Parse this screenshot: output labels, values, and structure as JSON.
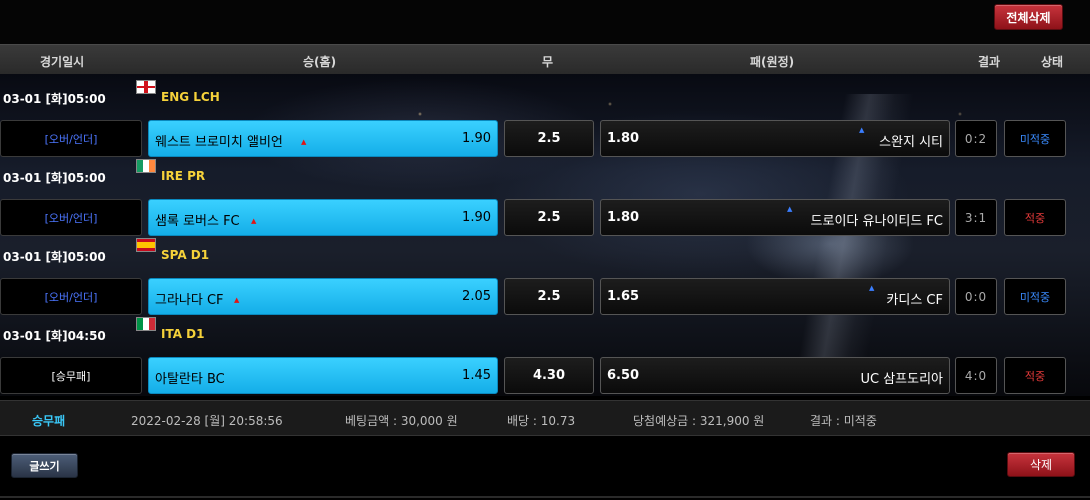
{
  "toolbar": {
    "delete_all_label": "전체삭제"
  },
  "header": {
    "datetime": "경기일시",
    "home": "승(홈)",
    "draw": "무",
    "away": "패(원정)",
    "result": "결과",
    "status": "상태"
  },
  "matches": [
    {
      "datetime": "03-01 [화]05:00",
      "flag": "england-flag-icon",
      "league": "ENG LCH",
      "bet_type": "[오버/언더]",
      "home_team": "웨스트 브로미치 앨비언",
      "home_odds": "1.90",
      "draw": "2.5",
      "away_odds": "1.80",
      "away_team": "스완지 시티",
      "score": "0:2",
      "status": "미적중"
    },
    {
      "datetime": "03-01 [화]05:00",
      "flag": "ireland-flag-icon",
      "league": "IRE PR",
      "bet_type": "[오버/언더]",
      "home_team": "샘록 로버스 FC",
      "home_odds": "1.90",
      "draw": "2.5",
      "away_odds": "1.80",
      "away_team": "드로이다 유나이티드 FC",
      "score": "3:1",
      "status": "적중"
    },
    {
      "datetime": "03-01 [화]05:00",
      "flag": "spain-flag-icon",
      "league": "SPA D1",
      "bet_type": "[오버/언더]",
      "home_team": "그라나다 CF",
      "home_odds": "2.05",
      "draw": "2.5",
      "away_odds": "1.65",
      "away_team": "카디스 CF",
      "score": "0:0",
      "status": "미적중"
    },
    {
      "datetime": "03-01 [화]04:50",
      "flag": "italy-flag-icon",
      "league": "ITA D1",
      "bet_type": "[승무패]",
      "home_team": "아탈란타 BC",
      "home_odds": "1.45",
      "draw": "4.30",
      "away_odds": "6.50",
      "away_team": "UC 삼프도리아",
      "score": "4:0",
      "status": "적중"
    }
  ],
  "summary": {
    "label": "승무패",
    "datetime": "2022-02-28 [월] 20:58:56",
    "bet_amount": "베팅금액 : 30,000 원",
    "odds": "배당 : 10.73",
    "expected_win": "당첨예상금 : 321,900 원",
    "result": "결과 : 미적중"
  },
  "footer": {
    "write_label": "글쓰기",
    "delete_label": "삭제"
  },
  "colors": {
    "home_box": "#22bff5",
    "league_text": "#f6d23a",
    "pending": "#3a8cff",
    "hit": "#e53a3a",
    "overunder_text": "#4c76ff"
  }
}
